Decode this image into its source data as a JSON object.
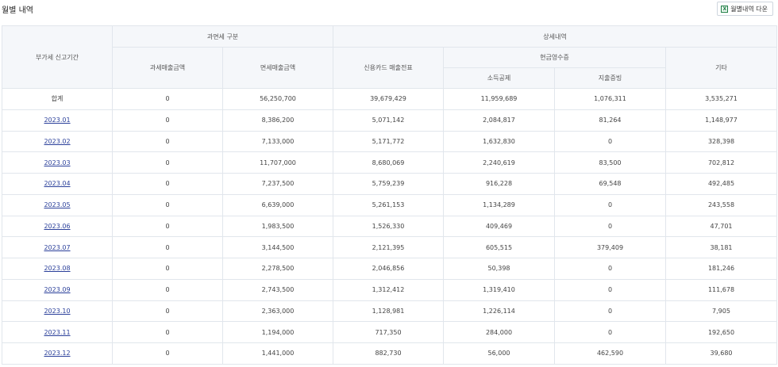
{
  "header": {
    "title": "월별 내역",
    "download_label": "월별내역 다운"
  },
  "table": {
    "group_headers": {
      "tax_type": "과면세 구분",
      "detail": "상세내역",
      "cash_receipt": "현금영수증"
    },
    "columns": {
      "period": "부가세 신고기간",
      "taxable_sales": "과세매출금액",
      "tax_free_sales": "면세매출금액",
      "card_sales": "신용카드 매출전표",
      "income_deduction": "소득공제",
      "expense_proof": "지출증빙",
      "other": "기타"
    },
    "rows": [
      {
        "period": "합계",
        "taxable": "0",
        "tax_free": "56,250,700",
        "card": "39,679,429",
        "income": "11,959,689",
        "expense": "1,076,311",
        "other": "3,535,271"
      },
      {
        "period": "2023.01",
        "taxable": "0",
        "tax_free": "8,386,200",
        "card": "5,071,142",
        "income": "2,084,817",
        "expense": "81,264",
        "other": "1,148,977"
      },
      {
        "period": "2023.02",
        "taxable": "0",
        "tax_free": "7,133,000",
        "card": "5,171,772",
        "income": "1,632,830",
        "expense": "0",
        "other": "328,398"
      },
      {
        "period": "2023.03",
        "taxable": "0",
        "tax_free": "11,707,000",
        "card": "8,680,069",
        "income": "2,240,619",
        "expense": "83,500",
        "other": "702,812"
      },
      {
        "period": "2023.04",
        "taxable": "0",
        "tax_free": "7,237,500",
        "card": "5,759,239",
        "income": "916,228",
        "expense": "69,548",
        "other": "492,485"
      },
      {
        "period": "2023.05",
        "taxable": "0",
        "tax_free": "6,639,000",
        "card": "5,261,153",
        "income": "1,134,289",
        "expense": "0",
        "other": "243,558"
      },
      {
        "period": "2023.06",
        "taxable": "0",
        "tax_free": "1,983,500",
        "card": "1,526,330",
        "income": "409,469",
        "expense": "0",
        "other": "47,701"
      },
      {
        "period": "2023.07",
        "taxable": "0",
        "tax_free": "3,144,500",
        "card": "2,121,395",
        "income": "605,515",
        "expense": "379,409",
        "other": "38,181"
      },
      {
        "period": "2023.08",
        "taxable": "0",
        "tax_free": "2,278,500",
        "card": "2,046,856",
        "income": "50,398",
        "expense": "0",
        "other": "181,246"
      },
      {
        "period": "2023.09",
        "taxable": "0",
        "tax_free": "2,743,500",
        "card": "1,312,412",
        "income": "1,319,410",
        "expense": "0",
        "other": "111,678"
      },
      {
        "period": "2023.10",
        "taxable": "0",
        "tax_free": "2,363,000",
        "card": "1,128,981",
        "income": "1,226,114",
        "expense": "0",
        "other": "7,905"
      },
      {
        "period": "2023.11",
        "taxable": "0",
        "tax_free": "1,194,000",
        "card": "717,350",
        "income": "284,000",
        "expense": "0",
        "other": "192,650"
      },
      {
        "period": "2023.12",
        "taxable": "0",
        "tax_free": "1,441,000",
        "card": "882,730",
        "income": "56,000",
        "expense": "462,590",
        "other": "39,680"
      }
    ]
  },
  "icons": {
    "download": "excel-icon",
    "excel_glyph": "X"
  },
  "colors": {
    "header_bg": "#f5f7fa",
    "border": "#e1e6ec",
    "link": "#2a3f9a",
    "excel": "#1e7e45"
  }
}
